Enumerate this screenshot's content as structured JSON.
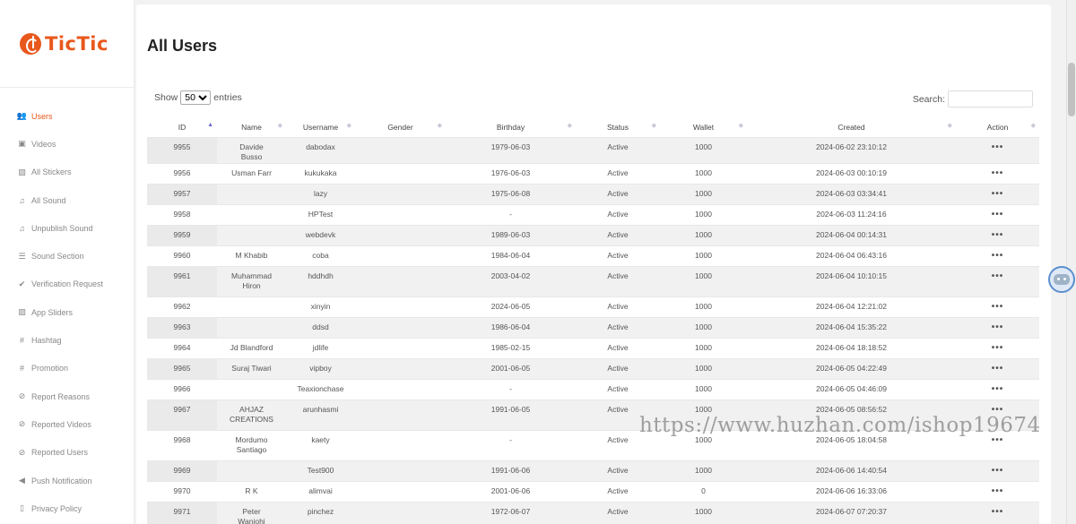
{
  "brand": {
    "name": "TicTic",
    "color": "#e8581c"
  },
  "sidebar": {
    "items": [
      {
        "label": "Users",
        "icon": "users-icon",
        "glyph": "👥",
        "active": true
      },
      {
        "label": "Videos",
        "icon": "video-icon",
        "glyph": "▣",
        "active": false
      },
      {
        "label": "All Stickers",
        "icon": "image-icon",
        "glyph": "▨",
        "active": false
      },
      {
        "label": "All Sound",
        "icon": "music-icon",
        "glyph": "♫",
        "active": false
      },
      {
        "label": "Unpublish Sound",
        "icon": "music-icon",
        "glyph": "♫",
        "active": false
      },
      {
        "label": "Sound Section",
        "icon": "list-icon",
        "glyph": "☰",
        "active": false
      },
      {
        "label": "Verification Request",
        "icon": "user-check-icon",
        "glyph": "✔",
        "active": false
      },
      {
        "label": "App Sliders",
        "icon": "image-icon",
        "glyph": "▨",
        "active": false
      },
      {
        "label": "Hashtag",
        "icon": "hashtag-icon",
        "glyph": "#",
        "active": false
      },
      {
        "label": "Promotion",
        "icon": "hashtag-icon",
        "glyph": "#",
        "active": false
      },
      {
        "label": "Report Reasons",
        "icon": "ban-icon",
        "glyph": "⊘",
        "active": false
      },
      {
        "label": "Reported Videos",
        "icon": "ban-icon",
        "glyph": "⊘",
        "active": false
      },
      {
        "label": "Reported Users",
        "icon": "ban-icon",
        "glyph": "⊘",
        "active": false
      },
      {
        "label": "Push Notification",
        "icon": "megaphone-icon",
        "glyph": "◀",
        "active": false
      },
      {
        "label": "Privacy Policy",
        "icon": "document-icon",
        "glyph": "▯",
        "active": false
      }
    ]
  },
  "main": {
    "title": "All Users",
    "length": {
      "show": "Show",
      "value": "50",
      "entries": "entries"
    },
    "search": {
      "label": "Search:",
      "value": ""
    },
    "columns": [
      "ID",
      "Name",
      "Username",
      "Gender",
      "Birthday",
      "Status",
      "Wallet",
      "Created",
      "Action"
    ],
    "rows": [
      {
        "id": "9955",
        "name": "Davide Busso",
        "username": "dabodax",
        "gender": "",
        "birthday": "1979-06-03",
        "status": "Active",
        "wallet": "1000",
        "created": "2024-06-02 23:10:12"
      },
      {
        "id": "9956",
        "name": "Usman Farr",
        "username": "kukukaka",
        "gender": "",
        "birthday": "1976-06-03",
        "status": "Active",
        "wallet": "1000",
        "created": "2024-06-03 00:10:19"
      },
      {
        "id": "9957",
        "name": "",
        "username": "lazy",
        "gender": "",
        "birthday": "1975-06-08",
        "status": "Active",
        "wallet": "1000",
        "created": "2024-06-03 03:34:41"
      },
      {
        "id": "9958",
        "name": "",
        "username": "HPTest",
        "gender": "",
        "birthday": "-",
        "status": "Active",
        "wallet": "1000",
        "created": "2024-06-03 11:24:16"
      },
      {
        "id": "9959",
        "name": "",
        "username": "webdevk",
        "gender": "",
        "birthday": "1989-06-03",
        "status": "Active",
        "wallet": "1000",
        "created": "2024-06-04 00:14:31"
      },
      {
        "id": "9960",
        "name": "M Khabib",
        "username": "coba",
        "gender": "",
        "birthday": "1984-06-04",
        "status": "Active",
        "wallet": "1000",
        "created": "2024-06-04 06:43:16"
      },
      {
        "id": "9961",
        "name": "Muhammad Hiron",
        "username": "hddhdh",
        "gender": "",
        "birthday": "2003-04-02",
        "status": "Active",
        "wallet": "1000",
        "created": "2024-06-04 10:10:15"
      },
      {
        "id": "9962",
        "name": "",
        "username": "xinyin",
        "gender": "",
        "birthday": "2024-06-05",
        "status": "Active",
        "wallet": "1000",
        "created": "2024-06-04 12:21:02"
      },
      {
        "id": "9963",
        "name": "",
        "username": "ddsd",
        "gender": "",
        "birthday": "1986-06-04",
        "status": "Active",
        "wallet": "1000",
        "created": "2024-06-04 15:35:22"
      },
      {
        "id": "9964",
        "name": "Jd Blandford",
        "username": "jdlife",
        "gender": "",
        "birthday": "1985-02-15",
        "status": "Active",
        "wallet": "1000",
        "created": "2024-06-04 18:18:52"
      },
      {
        "id": "9965",
        "name": "Suraj Tiwari",
        "username": "vipboy",
        "gender": "",
        "birthday": "2001-06-05",
        "status": "Active",
        "wallet": "1000",
        "created": "2024-06-05 04:22:49"
      },
      {
        "id": "9966",
        "name": "",
        "username": "Teaxionchase",
        "gender": "",
        "birthday": "-",
        "status": "Active",
        "wallet": "1000",
        "created": "2024-06-05 04:46:09"
      },
      {
        "id": "9967",
        "name": "AHJAZ CREATIONS",
        "username": "arunhasmi",
        "gender": "",
        "birthday": "1991-06-05",
        "status": "Active",
        "wallet": "1000",
        "created": "2024-06-05 08:56:52"
      },
      {
        "id": "9968",
        "name": "Mordumo Santiago",
        "username": "kaety",
        "gender": "",
        "birthday": "-",
        "status": "Active",
        "wallet": "1000",
        "created": "2024-06-05 18:04:58"
      },
      {
        "id": "9969",
        "name": "",
        "username": "Test900",
        "gender": "",
        "birthday": "1991-06-06",
        "status": "Active",
        "wallet": "1000",
        "created": "2024-06-06 14:40:54"
      },
      {
        "id": "9970",
        "name": "R K",
        "username": "alimvai",
        "gender": "",
        "birthday": "2001-06-06",
        "status": "Active",
        "wallet": "0",
        "created": "2024-06-06 16:33:06"
      },
      {
        "id": "9971",
        "name": "Peter Wanjohi",
        "username": "pinchez",
        "gender": "",
        "birthday": "1972-06-07",
        "status": "Active",
        "wallet": "1000",
        "created": "2024-06-07 07:20:37"
      }
    ],
    "action_glyph": "•••"
  },
  "watermark": "https://www.huzhan.com/ishop19674"
}
